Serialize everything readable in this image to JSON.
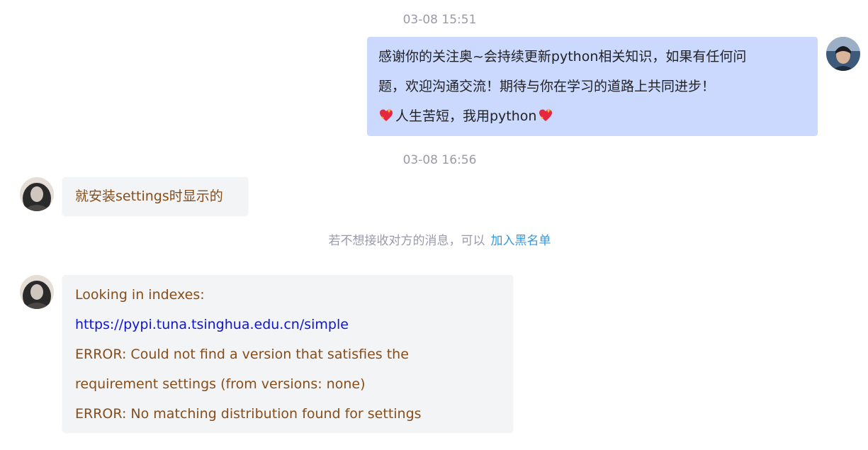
{
  "messages": [
    {
      "time": "03-08 15:51"
    },
    {
      "time": "03-08 16:56",
      "me_lines": [
        "感谢你的关注奥~会持续更新python相关知识，如果有任何问",
        "题，欢迎沟通交流！期待与你在学习的道路上共同进步！",
        "人生苦短，我用python"
      ]
    }
  ],
  "other_message_1": "就安装settings时显示的",
  "notice": {
    "text": "若不想接收对方的消息，可以",
    "link": "加入黑名单"
  },
  "other_message_2": {
    "line1": "Looking in indexes:",
    "link": "https://pypi.tuna.tsinghua.edu.cn/simple",
    "line3": "ERROR: Could not find a version that satisfies the",
    "line4": "requirement settings (from versions: none)",
    "line5": "ERROR: No matching distribution found for settings"
  },
  "colors": {
    "my_bubble": "#cad9fd",
    "their_bubble": "#f3f4f6",
    "their_text": "#864d1a",
    "link": "#1015cf",
    "notice_link": "#3a98d8",
    "timestamp": "#999aaa"
  },
  "icons": {
    "emoji": "sparkling-heart-icon"
  }
}
